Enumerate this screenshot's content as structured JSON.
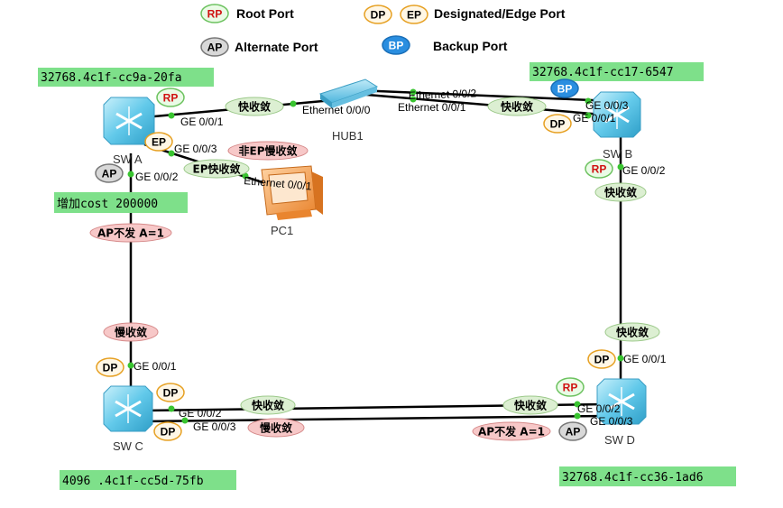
{
  "legend": {
    "rp": {
      "badge": "RP",
      "label": "Root Port"
    },
    "dp_ep": {
      "badge1": "DP",
      "badge2": "EP",
      "label": "Designated/Edge Port"
    },
    "ap": {
      "badge": "AP",
      "label": "Alternate Port"
    },
    "bp": {
      "badge": "BP",
      "label": "Backup Port"
    }
  },
  "bridge_ids": {
    "swa": "32768.4c1f-cc9a-20fa",
    "swb": "32768.4c1f-cc17-6547",
    "swc": "4096 .4c1f-cc5d-75fb",
    "swd": "32768.4c1f-cc36-1ad6"
  },
  "nodes": {
    "swa": "SW A",
    "swb": "SW B",
    "swc": "SW C",
    "swd": "SW D",
    "hub": "HUB1",
    "pc": "PC1"
  },
  "interfaces": {
    "a_ge001": "GE 0/0/1",
    "a_ge003": "GE 0/0/3",
    "a_ge002": "GE 0/0/2",
    "hub_e000": "Ethernet 0/0/0",
    "hub_e002": "Ethernet 0/0/2",
    "hub_e001": "Ethernet 0/0/1",
    "b_ge003": "GE 0/0/3",
    "b_ge001": "GE 0/0/1",
    "b_ge002": "GE 0/0/2",
    "pc_e001": "Ethernet 0/0/1",
    "c_ge001": "GE 0/0/1",
    "c_ge002": "GE 0/0/2",
    "c_ge003": "GE 0/0/3",
    "d_ge001": "GE 0/0/1",
    "d_ge002": "GE 0/0/2",
    "d_ge003": "GE 0/0/3"
  },
  "port_roles": {
    "a_rp": "RP",
    "a_ep": "EP",
    "a_ap": "AP",
    "b_bp": "BP",
    "b_dp": "DP",
    "b_rp": "RP",
    "c_dp1": "DP",
    "c_dp2": "DP",
    "c_dp3": "DP",
    "d_dp": "DP",
    "d_rp": "RP",
    "d_ap": "AP"
  },
  "link_notes": {
    "a_hub_fast": "快收敛",
    "hub_b_fast": "快收敛",
    "non_ep_slow": "非EP慢收敛",
    "ep_fast": "EP快收敛",
    "b_down_fast": "快收敛",
    "d_up_fast": "快收敛",
    "a_cost": "增加cost 200000",
    "a_ap_nosend": "AP不发 A=1",
    "c_up_slow": "慢收敛",
    "cd_fast_left": "快收敛",
    "cd_fast_right": "快收敛",
    "cd_slow": "慢收敛",
    "d_ap_nosend": "AP不发 A=1"
  },
  "colors": {
    "id_box": "#7ee08a",
    "fast_pill": "#dcefd2",
    "slow_pill": "#f7c8c8",
    "link_dot": "#39c430",
    "switch_blue": "#5ec8e8",
    "bp_blue": "#2a8ee0"
  }
}
